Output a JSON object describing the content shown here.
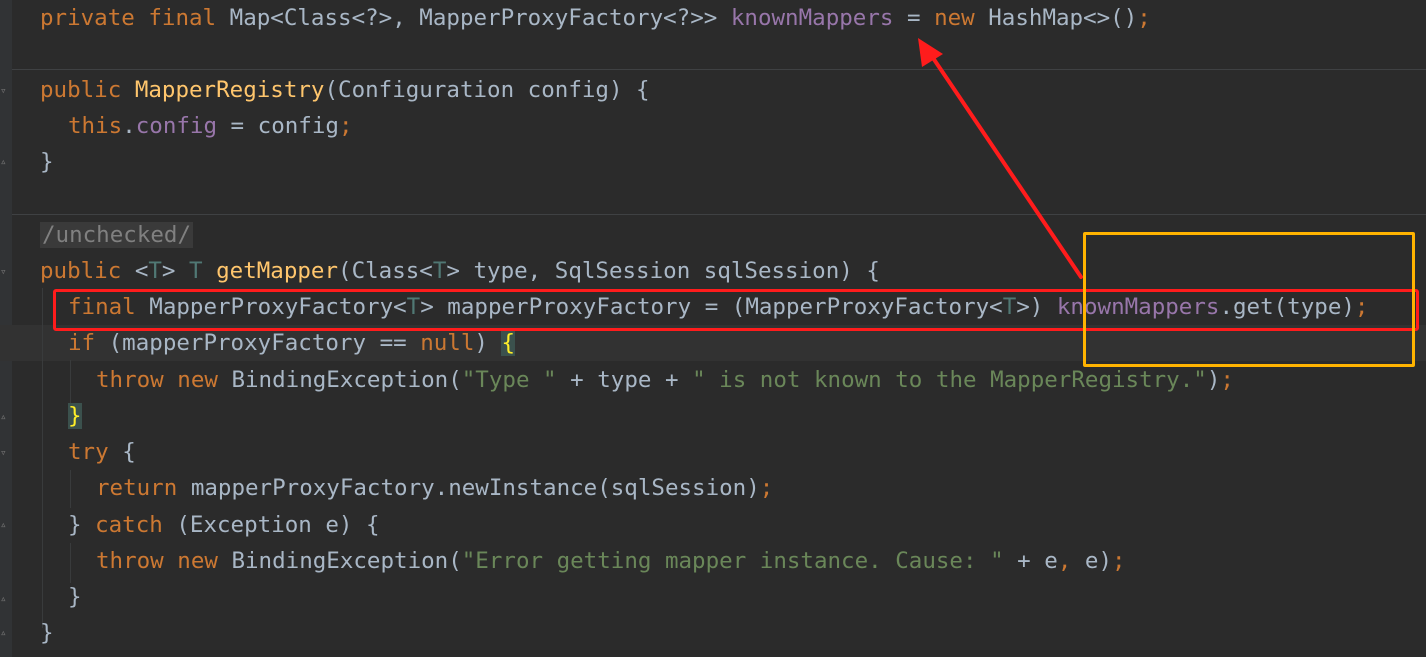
{
  "editor": {
    "lines": [
      {
        "id": "field-decl",
        "tokens": [
          {
            "t": "private final ",
            "c": "kw"
          },
          {
            "t": "Map<Class<?>, MapperProxyFactory<?>> ",
            "c": ""
          },
          {
            "t": "knownMappers",
            "c": "fld"
          },
          {
            "t": " = ",
            "c": ""
          },
          {
            "t": "new ",
            "c": "kw"
          },
          {
            "t": "HashMap<>()",
            "c": ""
          },
          {
            "t": ";",
            "c": "kw"
          }
        ]
      },
      {
        "id": "ctor-sig",
        "tokens": [
          {
            "t": "public ",
            "c": "kw"
          },
          {
            "t": "MapperRegistry",
            "c": "mth"
          },
          {
            "t": "(Configuration config) {",
            "c": ""
          }
        ]
      },
      {
        "id": "ctor-body",
        "tokens": [
          {
            "t": "this",
            "c": "kw"
          },
          {
            "t": ".",
            "c": ""
          },
          {
            "t": "config",
            "c": "fld"
          },
          {
            "t": " = config",
            "c": ""
          },
          {
            "t": ";",
            "c": "kw"
          }
        ]
      },
      {
        "id": "ctor-close",
        "tokens": [
          {
            "t": "}",
            "c": ""
          }
        ]
      },
      {
        "id": "annotation",
        "tokens": [
          {
            "t": "/unchecked/",
            "c": "cmt"
          }
        ]
      },
      {
        "id": "method-sig",
        "tokens": [
          {
            "t": "public ",
            "c": "kw"
          },
          {
            "t": "<",
            "c": ""
          },
          {
            "t": "T",
            "c": "tp"
          },
          {
            "t": "> ",
            "c": ""
          },
          {
            "t": "T ",
            "c": "tp"
          },
          {
            "t": "getMapper",
            "c": "mth"
          },
          {
            "t": "(Class<",
            "c": ""
          },
          {
            "t": "T",
            "c": "tp"
          },
          {
            "t": "> type, SqlSession sqlSession) {",
            "c": ""
          }
        ]
      },
      {
        "id": "factory-line",
        "tokens": [
          {
            "t": "final ",
            "c": "kw"
          },
          {
            "t": "MapperProxyFactory<",
            "c": ""
          },
          {
            "t": "T",
            "c": "tp"
          },
          {
            "t": "> mapperProxyFactory = (MapperProxyFactory<",
            "c": ""
          },
          {
            "t": "T",
            "c": "tp"
          },
          {
            "t": ">) ",
            "c": ""
          },
          {
            "t": "knownMappers",
            "c": "fld"
          },
          {
            "t": ".get(type)",
            "c": ""
          },
          {
            "t": ";",
            "c": "kw"
          }
        ]
      },
      {
        "id": "if-line",
        "tokens": [
          {
            "t": "if ",
            "c": "kw"
          },
          {
            "t": "(mapperProxyFactory == ",
            "c": ""
          },
          {
            "t": "null",
            "c": "kw"
          },
          {
            "t": ") ",
            "c": ""
          },
          {
            "t": "{",
            "c": "brace-hl"
          }
        ]
      },
      {
        "id": "throw-line-1",
        "tokens": [
          {
            "t": "throw new ",
            "c": "kw"
          },
          {
            "t": "BindingException(",
            "c": ""
          },
          {
            "t": "\"Type \"",
            "c": "str"
          },
          {
            "t": " + type + ",
            "c": ""
          },
          {
            "t": "\" is not known to the MapperRegistry.\"",
            "c": "str"
          },
          {
            "t": ")",
            "c": ""
          },
          {
            "t": ";",
            "c": "kw"
          }
        ]
      },
      {
        "id": "if-close",
        "tokens": [
          {
            "t": "}",
            "c": "brace-hl"
          }
        ]
      },
      {
        "id": "try-line",
        "tokens": [
          {
            "t": "try ",
            "c": "kw"
          },
          {
            "t": "{",
            "c": ""
          }
        ]
      },
      {
        "id": "return-line",
        "tokens": [
          {
            "t": "return ",
            "c": "kw"
          },
          {
            "t": "mapperProxyFactory.newInstance(sqlSession)",
            "c": ""
          },
          {
            "t": ";",
            "c": "kw"
          }
        ]
      },
      {
        "id": "catch-line",
        "tokens": [
          {
            "t": "} ",
            "c": ""
          },
          {
            "t": "catch ",
            "c": "kw"
          },
          {
            "t": "(Exception e) {",
            "c": ""
          }
        ]
      },
      {
        "id": "throw-line-2",
        "tokens": [
          {
            "t": "throw new ",
            "c": "kw"
          },
          {
            "t": "BindingException(",
            "c": ""
          },
          {
            "t": "\"Error getting mapper instance. Cause: \"",
            "c": "str"
          },
          {
            "t": " + e",
            "c": ""
          },
          {
            "t": ", ",
            "c": "kw"
          },
          {
            "t": "e)",
            "c": ""
          },
          {
            "t": ";",
            "c": "kw"
          }
        ]
      },
      {
        "id": "try-close",
        "tokens": [
          {
            "t": "}",
            "c": ""
          }
        ]
      },
      {
        "id": "method-close",
        "tokens": [
          {
            "t": "}",
            "c": ""
          }
        ]
      }
    ]
  },
  "annotations": {
    "red_box_color": "#ff1c1c",
    "yellow_box_color": "#ffb300",
    "arrow_color": "#ff1c1c"
  }
}
